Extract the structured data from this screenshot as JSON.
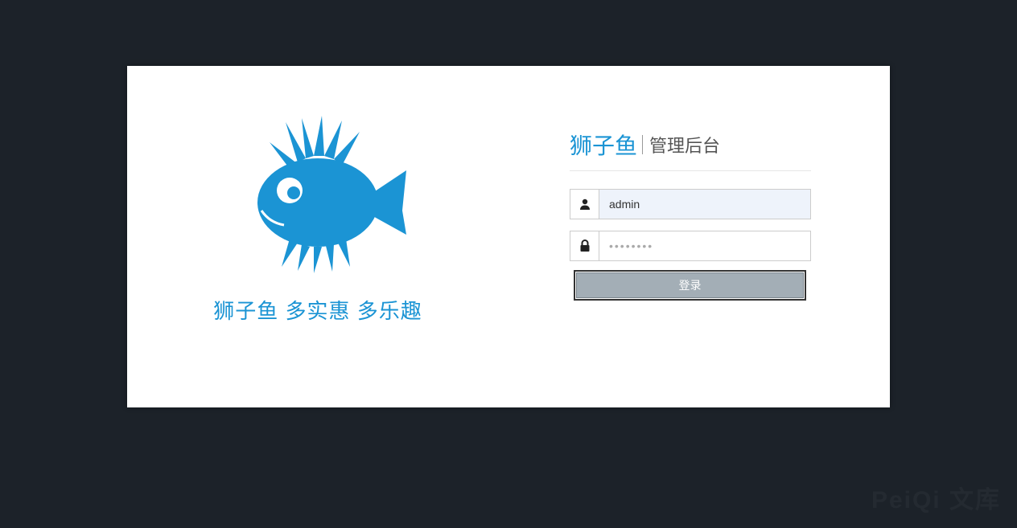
{
  "brand": "狮子鱼",
  "subtitle": "管理后台",
  "slogan": "狮子鱼  多实惠  多乐趣",
  "form": {
    "username_value": "admin",
    "password_placeholder": "••••••••",
    "login_label": "登录"
  },
  "watermark": "PeiQi 文库",
  "colors": {
    "accent": "#1b94d4",
    "bg": "#1c2229",
    "button": "#a3aeb6"
  }
}
